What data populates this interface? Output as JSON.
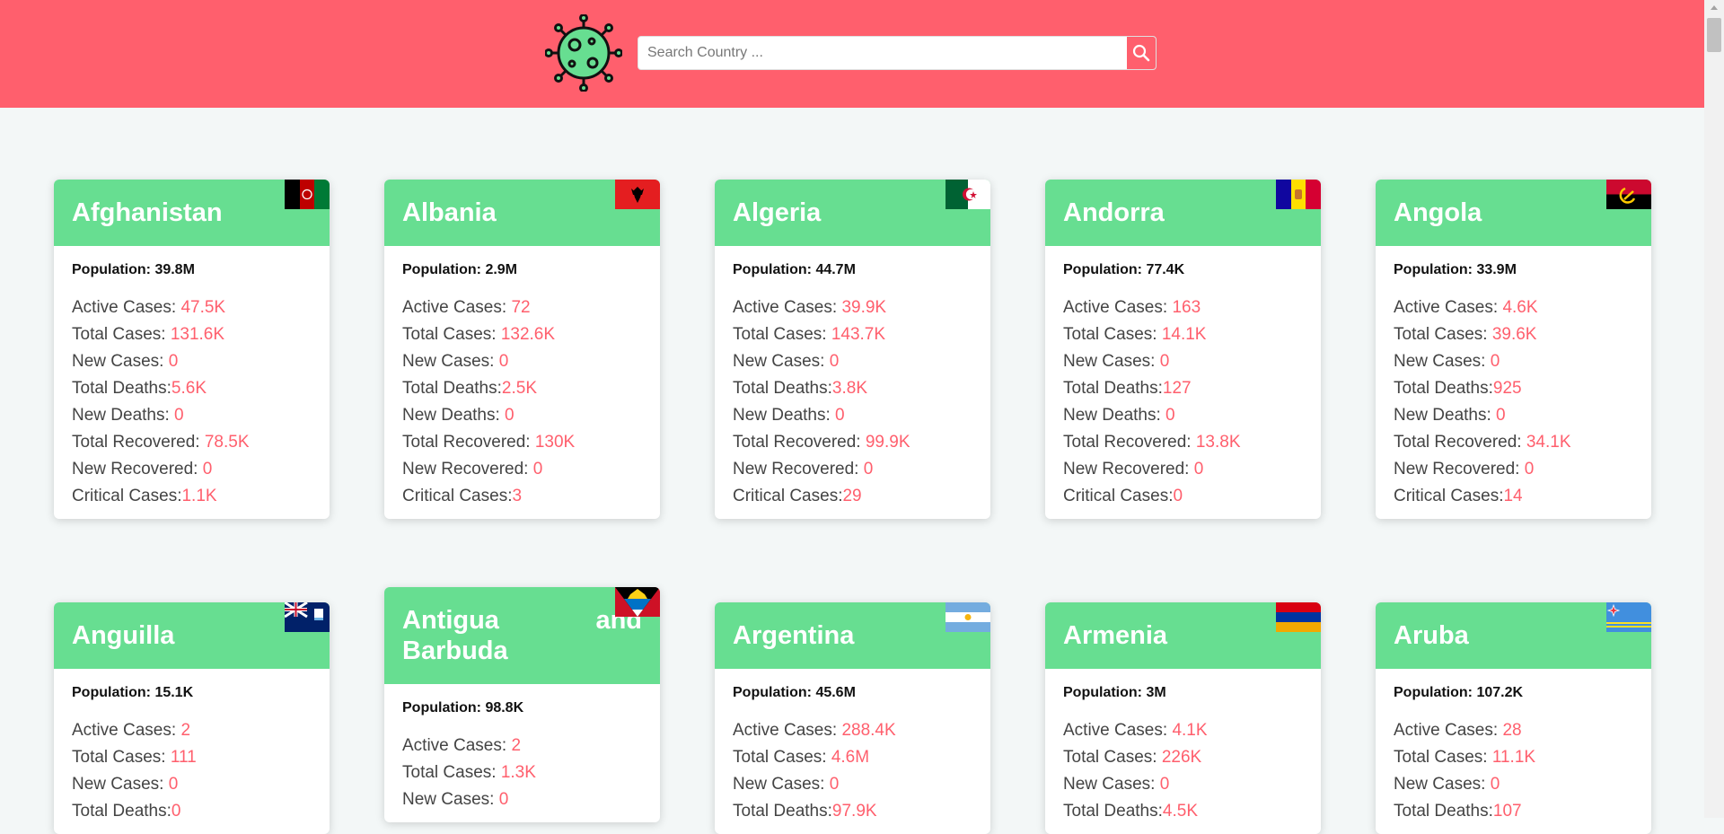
{
  "search": {
    "placeholder": "Search Country ..."
  },
  "labels": {
    "population": "Population: ",
    "active": "Active Cases: ",
    "total": "Total Cases: ",
    "new_cases": "New Cases: ",
    "total_deaths": "Total Deaths:",
    "new_deaths": "New Deaths: ",
    "total_recovered": "Total Recovered: ",
    "new_recovered": "New Recovered: ",
    "critical": "Critical Cases:"
  },
  "colors": {
    "header": "#ff5f6d",
    "card_head": "#67de91",
    "value": "#ff5f6d"
  },
  "countries": [
    {
      "name": "Afghanistan",
      "flag": "afghanistan-flag",
      "population": "39.8M",
      "active": "47.5K",
      "total": "131.6K",
      "new_cases": "0",
      "total_deaths": "5.6K",
      "new_deaths": "0",
      "total_recovered": "78.5K",
      "new_recovered": "0",
      "critical": "1.1K"
    },
    {
      "name": "Albania",
      "flag": "albania-flag",
      "population": "2.9M",
      "active": "72",
      "total": "132.6K",
      "new_cases": "0",
      "total_deaths": "2.5K",
      "new_deaths": "0",
      "total_recovered": "130K",
      "new_recovered": "0",
      "critical": "3"
    },
    {
      "name": "Algeria",
      "flag": "algeria-flag",
      "population": "44.7M",
      "active": "39.9K",
      "total": "143.7K",
      "new_cases": "0",
      "total_deaths": "3.8K",
      "new_deaths": "0",
      "total_recovered": "99.9K",
      "new_recovered": "0",
      "critical": "29"
    },
    {
      "name": "Andorra",
      "flag": "andorra-flag",
      "population": "77.4K",
      "active": "163",
      "total": "14.1K",
      "new_cases": "0",
      "total_deaths": "127",
      "new_deaths": "0",
      "total_recovered": "13.8K",
      "new_recovered": "0",
      "critical": "0"
    },
    {
      "name": "Angola",
      "flag": "angola-flag",
      "population": "33.9M",
      "active": "4.6K",
      "total": "39.6K",
      "new_cases": "0",
      "total_deaths": "925",
      "new_deaths": "0",
      "total_recovered": "34.1K",
      "new_recovered": "0",
      "critical": "14"
    },
    {
      "name": "Anguilla",
      "flag": "anguilla-flag",
      "population": "15.1K",
      "active": "2",
      "total": "111",
      "new_cases": "0",
      "total_deaths": "0"
    },
    {
      "name": "Antigua and Barbuda",
      "flag": "antigua-flag",
      "population": "98.8K",
      "active": "2",
      "total": "1.3K",
      "new_cases": "0"
    },
    {
      "name": "Argentina",
      "flag": "argentina-flag",
      "population": "45.6M",
      "active": "288.4K",
      "total": "4.6M",
      "new_cases": "0",
      "total_deaths": "97.9K"
    },
    {
      "name": "Armenia",
      "flag": "armenia-flag",
      "population": "3M",
      "active": "4.1K",
      "total": "226K",
      "new_cases": "0",
      "total_deaths": "4.5K"
    },
    {
      "name": "Aruba",
      "flag": "aruba-flag",
      "population": "107.2K",
      "active": "28",
      "total": "11.1K",
      "new_cases": "0",
      "total_deaths": "107"
    }
  ]
}
